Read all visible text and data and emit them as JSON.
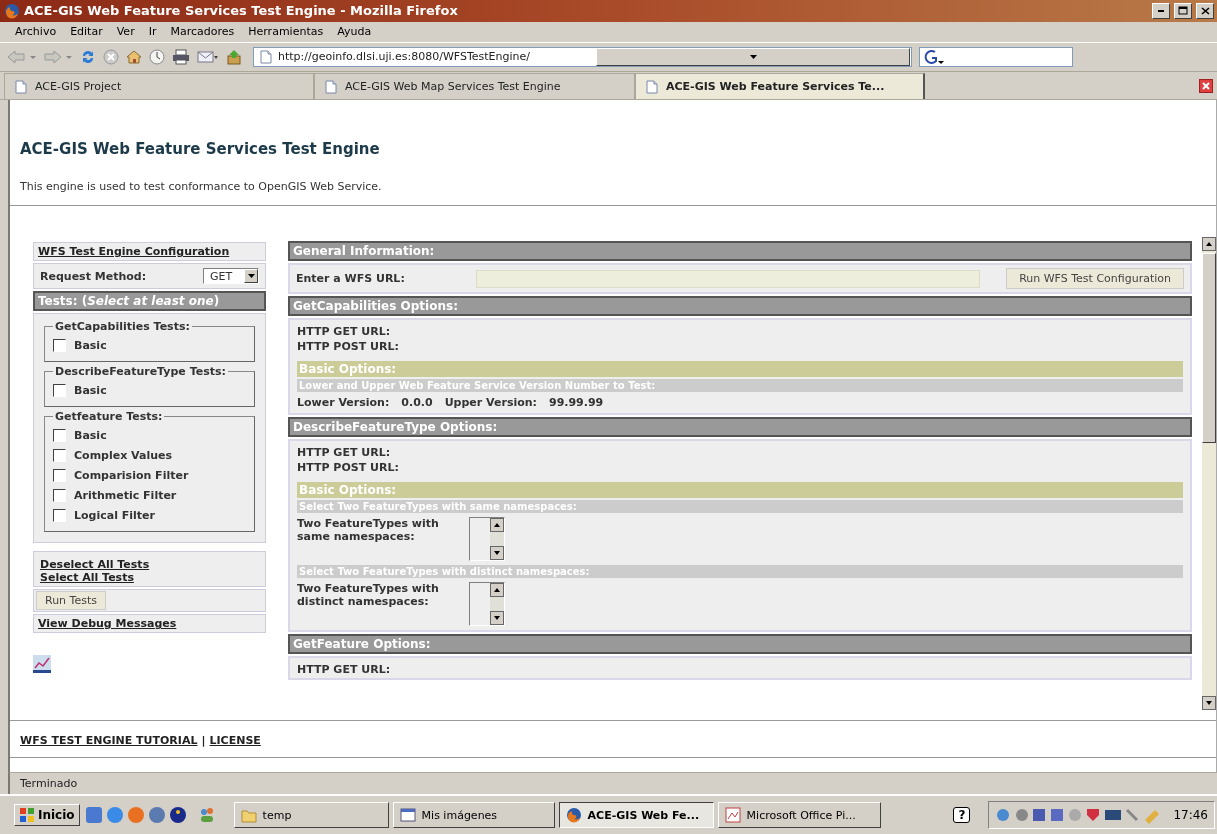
{
  "window": {
    "title": "ACE-GIS Web Feature Services Test Engine - Mozilla Firefox"
  },
  "menu": [
    "Archivo",
    "Editar",
    "Ver",
    "Ir",
    "Marcadores",
    "Herramientas",
    "Ayuda"
  ],
  "address": {
    "value": "http://geoinfo.dlsi.uji.es:8080/WFSTestEngine/"
  },
  "tabs": [
    {
      "label": "ACE-GIS Project",
      "selected": false
    },
    {
      "label": "ACE-GIS Web Map Services Test Engine",
      "selected": false
    },
    {
      "label": "ACE-GIS Web Feature Services Te...",
      "selected": true
    }
  ],
  "page": {
    "heading": "ACE-GIS Web Feature Services Test Engine",
    "description": "This engine is used to test conformance to OpenGIS Web Service."
  },
  "sidebar": {
    "config_link": "WFS Test Engine Configuration",
    "request_method_label": "Request Method:",
    "request_method": "GET",
    "tests_heading": "Tests: (*Select at least one*)",
    "groups": [
      {
        "legend": "GetCapabilities Tests:",
        "options": [
          {
            "label": "Basic",
            "checked": false
          }
        ]
      },
      {
        "legend": "DescribeFeatureType Tests:",
        "options": [
          {
            "label": "Basic",
            "checked": false
          }
        ]
      },
      {
        "legend": "Getfeature Tests:",
        "options": [
          {
            "label": "Basic",
            "checked": false
          },
          {
            "label": "Complex Values",
            "checked": false
          },
          {
            "label": "Comparision Filter",
            "checked": false
          },
          {
            "label": "Arithmetic Filter",
            "checked": false
          },
          {
            "label": "Logical Filter",
            "checked": false
          }
        ]
      }
    ],
    "select_links": [
      "Deselect All Tests",
      "Select All Tests"
    ],
    "run_button": "Run Tests",
    "debug_link": "View Debug Messages"
  },
  "sections": [
    {
      "heading": "General Information:",
      "kind": "url-entry",
      "label": "Enter a WFS URL:",
      "button": "Run WFS Test Configuration"
    },
    {
      "heading": "GetCapabilities Options:",
      "kind": "options",
      "urls": [
        "HTTP GET URL:",
        "HTTP POST URL:"
      ],
      "subheading": "Basic Options:",
      "blocks": [
        {
          "kind": "versions",
          "title": "Lower and Upper Web Feature Service Version Number to Test:",
          "items": [
            {
              "label": "Lower Version:",
              "value": "0.0.0"
            },
            {
              "label": "Upper Version:",
              "value": "99.99.99"
            }
          ]
        }
      ]
    },
    {
      "heading": "DescribeFeatureType Options:",
      "kind": "options",
      "urls": [
        "HTTP GET URL:",
        "HTTP POST URL:"
      ],
      "subheading": "Basic Options:",
      "blocks": [
        {
          "kind": "list-select",
          "title": "Select Two FeatureTypes with same namespaces:",
          "label": "Two FeatureTypes with same namespaces:"
        },
        {
          "kind": "list-select",
          "title": "Select Two FeatureTypes with distinct namespaces:",
          "label": "Two FeatureTypes with distinct namespaces:"
        }
      ]
    },
    {
      "heading": "GetFeature Options:",
      "kind": "options",
      "urls": [
        "HTTP GET URL:"
      ]
    }
  ],
  "footer": {
    "links": [
      "WFS TEST ENGINE TUTORIAL",
      "LICENSE"
    ],
    "separator": "|"
  },
  "status_bar": "Terminado",
  "taskbar": {
    "start": "Inicio",
    "buttons": [
      {
        "label": "temp",
        "kind": "folder",
        "selected": false
      },
      {
        "label": "Mis imágenes",
        "kind": "window",
        "selected": false
      },
      {
        "label": "ACE-GIS Web Fe...",
        "kind": "browser",
        "selected": true
      },
      {
        "label": "Microsoft Office Pi...",
        "kind": "viewer",
        "selected": false
      }
    ],
    "help": "?",
    "clock": "17:46"
  }
}
